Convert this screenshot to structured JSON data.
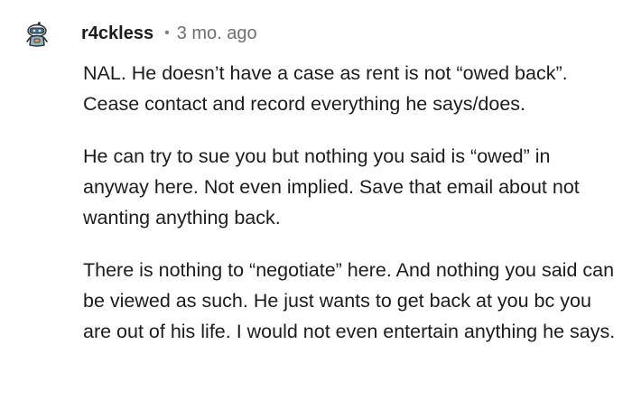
{
  "comment": {
    "avatar": "reddit-snoo-avatar-icon",
    "username": "r4ckless",
    "separator": "•",
    "timestamp": "3 mo. ago",
    "paragraphs": [
      "NAL. He doesn’t have a case as rent is not “owed back”. Cease contact and record everything he says/does.",
      "He can try to sue you but nothing you said is “owed” in anyway here. Not even implied. Save that email about not wanting anything back.",
      "There is nothing to “negotiate” here. And nothing you said can be viewed as such. He just wants to get back at you bc you are out of his life. I would not even entertain anything he says."
    ]
  },
  "colors": {
    "text": "#1c1c1c",
    "meta": "#6f6f6f",
    "background": "#ffffff"
  }
}
